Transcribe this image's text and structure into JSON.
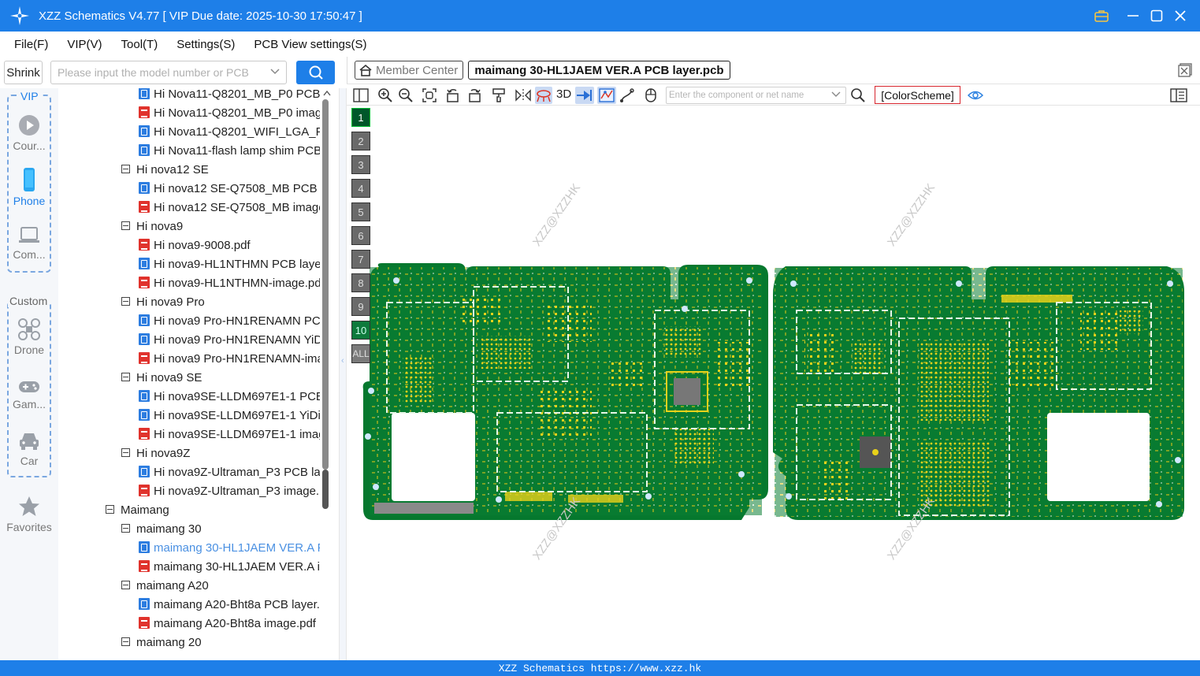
{
  "window": {
    "title": "XZZ Schematics V4.77 [ VIP Due date: 2025-10-30 17:50:47 ]"
  },
  "menu": [
    "File(F)",
    "VIP(V)",
    "Tool(T)",
    "Settings(S)",
    "PCB View settings(S)"
  ],
  "left_panel": {
    "shrink_label": "Shrink",
    "search_placeholder": "Please input the model number or PCB"
  },
  "rail": {
    "vip_label": "VIP",
    "custom_label": "Custom",
    "items": [
      {
        "label": "Cour...",
        "icon": "play-icon"
      },
      {
        "label": "Phone",
        "icon": "phone-icon"
      },
      {
        "label": "Com...",
        "icon": "laptop-icon"
      },
      {
        "label": "Drone",
        "icon": "drone-icon"
      },
      {
        "label": "Gam...",
        "icon": "gamepad-icon"
      },
      {
        "label": "Car",
        "icon": "car-icon"
      },
      {
        "label": "Favorites",
        "icon": "star-icon"
      }
    ]
  },
  "tree": [
    {
      "label": "Hi Nova11-Q8201_MB_P0 PCB l",
      "kind": "pcb",
      "level": 2
    },
    {
      "label": "Hi Nova11-Q8201_MB_P0 image",
      "kind": "pdf",
      "level": 2
    },
    {
      "label": "Hi Nova11-Q8201_WIFI_LGA_P1",
      "kind": "pcb",
      "level": 2
    },
    {
      "label": "Hi Nova11-flash lamp shim PCB",
      "kind": "pcb",
      "level": 2
    },
    {
      "label": "Hi nova12 SE",
      "kind": "folder",
      "level": 1
    },
    {
      "label": "Hi nova12 SE-Q7508_MB PCB la",
      "kind": "pcb",
      "level": 2
    },
    {
      "label": "Hi nova12 SE-Q7508_MB image",
      "kind": "pdf",
      "level": 2
    },
    {
      "label": "Hi nova9",
      "kind": "folder",
      "level": 1
    },
    {
      "label": "Hi nova9-9008.pdf",
      "kind": "pdf",
      "level": 2
    },
    {
      "label": "Hi nova9-HL1NTHMN PCB layer",
      "kind": "pcb",
      "level": 2
    },
    {
      "label": "Hi nova9-HL1NTHMN-image.pd",
      "kind": "pdf",
      "level": 2
    },
    {
      "label": "Hi nova9 Pro",
      "kind": "folder",
      "level": 1
    },
    {
      "label": "Hi nova9 Pro-HN1RENAMN PC",
      "kind": "pcb",
      "level": 2
    },
    {
      "label": "Hi nova9 Pro-HN1RENAMN YiD",
      "kind": "pcb",
      "level": 2
    },
    {
      "label": "Hi nova9 Pro-HN1RENAMN-ima",
      "kind": "pdf",
      "level": 2
    },
    {
      "label": "Hi nova9 SE",
      "kind": "folder",
      "level": 1
    },
    {
      "label": "Hi nova9SE-LLDM697E1-1 PCB",
      "kind": "pcb",
      "level": 2
    },
    {
      "label": "Hi nova9SE-LLDM697E1-1 YiDia",
      "kind": "pcb",
      "level": 2
    },
    {
      "label": "Hi nova9SE-LLDM697E1-1 imag",
      "kind": "pdf",
      "level": 2
    },
    {
      "label": "Hi nova9Z",
      "kind": "folder",
      "level": 1
    },
    {
      "label": "Hi nova9Z-Ultraman_P3 PCB lay",
      "kind": "pcb",
      "level": 2
    },
    {
      "label": "Hi nova9Z-Ultraman_P3 image.p",
      "kind": "pdf",
      "level": 2
    },
    {
      "label": "Maimang",
      "kind": "folder",
      "level": 0
    },
    {
      "label": "maimang 30",
      "kind": "folder",
      "level": 1
    },
    {
      "label": "maimang 30-HL1JAEM VER.A P",
      "kind": "pcb",
      "level": 2,
      "selected": true
    },
    {
      "label": "maimang 30-HL1JAEM VER.A ir",
      "kind": "pdf",
      "level": 2
    },
    {
      "label": "maimang A20",
      "kind": "folder",
      "level": 1
    },
    {
      "label": "maimang A20-Bht8a PCB layer.p",
      "kind": "pcb",
      "level": 2
    },
    {
      "label": "maimang A20-Bht8a image.pdf",
      "kind": "pdf",
      "level": 2
    },
    {
      "label": "maimang 20",
      "kind": "folder",
      "level": 1
    }
  ],
  "tabs": {
    "member_center": "Member Center",
    "active_file": "maimang 30-HL1JAEM VER.A PCB layer.pcb"
  },
  "toolbar": {
    "three_d_label": "3D",
    "component_placeholder": "Enter the component or net name",
    "color_scheme_label": "[ColorScheme]"
  },
  "layers": [
    "1",
    "2",
    "3",
    "4",
    "5",
    "6",
    "7",
    "8",
    "9",
    "10",
    "ALL"
  ],
  "active_layer": "1",
  "watermark_text": "XZZ@XZZHK",
  "status_bar": "XZZ Schematics https://www.xzz.hk",
  "colors": {
    "brand_blue": "#1e7fe8",
    "pcb_green": "#06782e",
    "pad_yellow": "#e8d21a",
    "selected_text": "#4a90e2",
    "scheme_border": "#d7262e"
  }
}
